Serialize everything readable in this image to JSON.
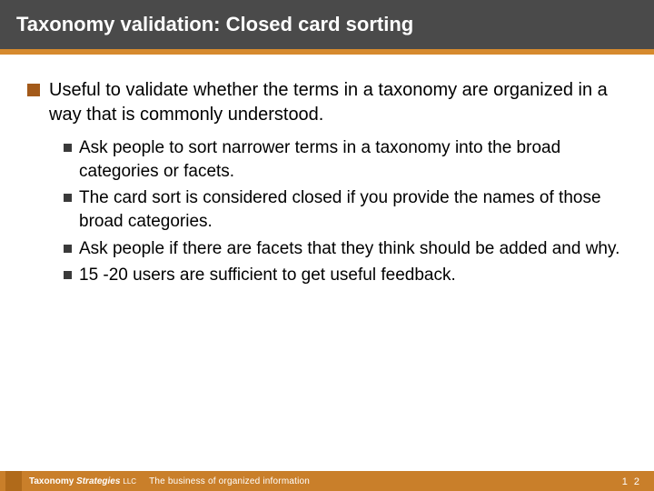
{
  "title": "Taxonomy validation: Closed card sorting",
  "main_point": "Useful to validate whether the terms in a taxonomy are organized in a way that is commonly understood.",
  "sub_points": [
    "Ask people to sort narrower terms in a taxonomy into the broad categories or facets.",
    "The card sort is considered closed if you provide the names of those broad categories.",
    "Ask people if there are facets that they think should be added and why.",
    "15 -20 users are sufficient to get useful feedback."
  ],
  "footer": {
    "company_part1": "Taxonomy ",
    "company_part2": "Strategies",
    "llc": "LLC",
    "tagline": "The business of organized information",
    "page": "1 2"
  }
}
